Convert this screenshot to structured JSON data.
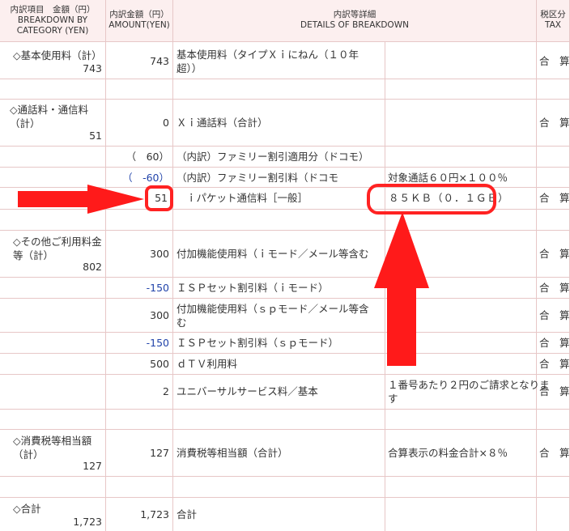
{
  "header": {
    "category": "内訳項目　金額（円）\nBREAKDOWN BY\nCATEGORY (YEN)",
    "amount": "内訳金額（円）\nAMOUNT(YEN)",
    "details": "内訳等詳細\nDETAILS OF BREAKDOWN",
    "tax": "税区分\nTAX"
  },
  "rows": {
    "basic_cat": "◇基本使用料（計）",
    "basic_cat_amt": "743",
    "basic_amt": "743",
    "basic_item": "基本使用料（タイプＸｉにねん（１０年\n超））",
    "basic_tax": "合　算",
    "call_cat": "◇通話料・通信料\n（計）",
    "call_cat_amt": "51",
    "call_amt": "0",
    "call_item": "Ｘｉ通話料（合計）",
    "call_tax": "合　算",
    "fam1_amt": "（　60）",
    "fam1_item": "（内訳）ファミリー割引適用分（ドコモ）",
    "fam2_amt": "（　-60）",
    "fam2_item": "（内訳）ファミリー割引料（ドコモ",
    "fam2_detail": "対象通話６０円×１００％",
    "packet_amt": "51",
    "packet_item": "ｉパケット通信料［一般］",
    "packet_detail": "８５ＫＢ（０．１ＧＢ）",
    "packet_tax": "合　算",
    "other_cat": "◇その他ご利用料金\n等（計）",
    "other_cat_amt": "802",
    "o1_amt": "300",
    "o1_item": "付加機能使用料（ｉモード／メール等含む",
    "o1_tax": "合　算",
    "o2_amt": "-150",
    "o2_item": "ＩＳＰセット割引料（ｉモード）",
    "o2_tax": "合　算",
    "o3_amt": "300",
    "o3_item": "付加機能使用料（ｓｐモード／メール等含\nむ",
    "o3_tax": "合　算",
    "o4_amt": "-150",
    "o4_item": "ＩＳＰセット割引料（ｓｐモード）",
    "o4_tax": "合　算",
    "o5_amt": "500",
    "o5_item": "ｄＴＶ利用料",
    "o5_tax": "合　算",
    "o6_amt": "2",
    "o6_item": "ユニバーサルサービス料／基本",
    "o6_detail": "１番号あたり２円のご請求となりま\nす",
    "o6_tax": "合　算",
    "taxc_cat": "◇消費税等相当額\n（計）",
    "taxc_cat_amt": "127",
    "taxc_amt": "127",
    "taxc_item": "消費税等相当額（合計）",
    "taxc_detail": "合算表示の料金合計×８％",
    "taxc_tax": "合　算",
    "total_cat": "◇合計",
    "total_cat_amt": "1,723",
    "total_amt": "1,723",
    "total_item": "合計"
  },
  "colors": {
    "accent": "#ff2222",
    "border": "#e7c7c7",
    "header_bg": "#fcefef",
    "negative": "#2244aa"
  }
}
